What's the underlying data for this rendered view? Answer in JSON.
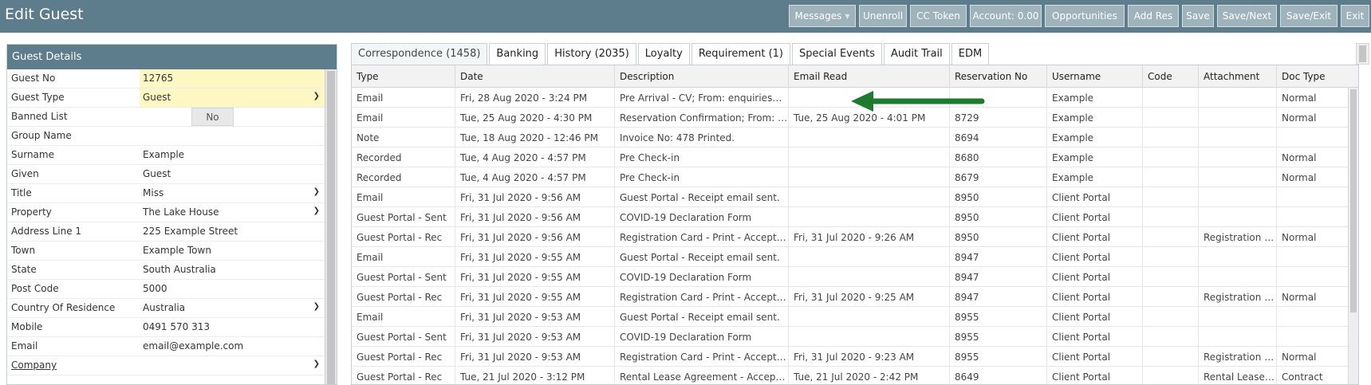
{
  "header": {
    "title": "Edit Guest"
  },
  "toolbar": [
    {
      "label": "Messages",
      "dropdown": true
    },
    {
      "label": "Unenroll"
    },
    {
      "label": "CC Token"
    },
    {
      "label": "Account: 0.00"
    },
    {
      "label": "Opportunities"
    },
    {
      "label": "Add Res"
    },
    {
      "label": "Save"
    },
    {
      "label": "Save/Next"
    },
    {
      "label": "Save/Exit"
    },
    {
      "label": "Exit"
    }
  ],
  "guest_details": {
    "title": "Guest Details",
    "fields": [
      {
        "label": "Guest No",
        "value": "12765"
      },
      {
        "label": "Guest Type",
        "value": "Guest"
      },
      {
        "label": "Banned List",
        "value": "No"
      },
      {
        "label": "Group Name",
        "value": ""
      },
      {
        "label": "Surname",
        "value": "Example"
      },
      {
        "label": "Given",
        "value": "Guest"
      },
      {
        "label": "Title",
        "value": "Miss"
      },
      {
        "label": "Property",
        "value": "The Lake House"
      },
      {
        "label": "Address Line 1",
        "value": "225 Example Street"
      },
      {
        "label": "Town",
        "value": "Example Town"
      },
      {
        "label": "State",
        "value": "South Australia"
      },
      {
        "label": "Post Code",
        "value": "5000"
      },
      {
        "label": "Country Of Residence",
        "value": "Australia"
      },
      {
        "label": "Mobile",
        "value": "0491 570 313"
      },
      {
        "label": "Email",
        "value": "email@example.com"
      },
      {
        "label": "Company",
        "value": ""
      }
    ]
  },
  "tabs": [
    {
      "label": "Correspondence (1458)"
    },
    {
      "label": "Banking"
    },
    {
      "label": "History (2035)"
    },
    {
      "label": "Loyalty"
    },
    {
      "label": "Requirement (1)"
    },
    {
      "label": "Special Events"
    },
    {
      "label": "Audit Trail"
    },
    {
      "label": "EDM"
    }
  ],
  "grid": {
    "columns": [
      "Type",
      "Date",
      "Description",
      "Email Read",
      "Reservation No",
      "Username",
      "Code",
      "Attachment",
      "Doc Type"
    ],
    "rows": [
      [
        "Email",
        "Fri, 28 Aug 2020 - 3:24 PM",
        "Pre Arrival - CV; From: enquiries@yourdomain.com",
        "",
        "",
        "Example",
        "",
        "",
        "Normal"
      ],
      [
        "Email",
        "Tue, 25 Aug 2020 - 4:30 PM",
        "Reservation Confirmation; From: enquiries@yourdomain.com",
        "Tue, 25 Aug 2020 - 4:01 PM",
        "8729",
        "Example",
        "",
        "",
        "Normal"
      ],
      [
        "Note",
        "Tue, 18 Aug 2020 - 12:46 PM",
        "Invoice No: 478 Printed.",
        "",
        "8694",
        "Example",
        "",
        "",
        ""
      ],
      [
        "Recorded",
        "Tue, 4 Aug 2020 - 4:57 PM",
        "Pre Check-in",
        "",
        "8680",
        "Example",
        "",
        "",
        "Normal"
      ],
      [
        "Recorded",
        "Tue, 4 Aug 2020 - 4:57 PM",
        "Pre Check-in",
        "",
        "8679",
        "Example",
        "",
        "",
        "Normal"
      ],
      [
        "Email",
        "Fri, 31 Jul 2020 - 9:56 AM",
        "Guest Portal - Receipt email sent.",
        "",
        "8950",
        "Client Portal",
        "",
        "",
        ""
      ],
      [
        "Guest Portal - Sent",
        "Fri, 31 Jul 2020 - 9:56 AM",
        "COVID-19 Declaration Form",
        "",
        "8950",
        "Client Portal",
        "",
        "",
        ""
      ],
      [
        "Guest Portal - Rec",
        "Fri, 31 Jul 2020 - 9:56 AM",
        "Registration Card - Print - Accepted",
        "Fri, 31 Jul 2020 - 9:26 AM",
        "8950",
        "Client Portal",
        "",
        "Registration Card.pdf",
        "Normal"
      ],
      [
        "Email",
        "Fri, 31 Jul 2020 - 9:55 AM",
        "Guest Portal - Receipt email sent.",
        "",
        "8947",
        "Client Portal",
        "",
        "",
        ""
      ],
      [
        "Guest Portal - Sent",
        "Fri, 31 Jul 2020 - 9:55 AM",
        "COVID-19 Declaration Form",
        "",
        "8947",
        "Client Portal",
        "",
        "",
        ""
      ],
      [
        "Guest Portal - Rec",
        "Fri, 31 Jul 2020 - 9:55 AM",
        "Registration Card - Print - Accepted",
        "Fri, 31 Jul 2020 - 9:25 AM",
        "8947",
        "Client Portal",
        "",
        "Registration Card.pdf",
        "Normal"
      ],
      [
        "Email",
        "Fri, 31 Jul 2020 - 9:53 AM",
        "Guest Portal - Receipt email sent.",
        "",
        "8955",
        "Client Portal",
        "",
        "",
        ""
      ],
      [
        "Guest Portal - Sent",
        "Fri, 31 Jul 2020 - 9:53 AM",
        "COVID-19 Declaration Form",
        "",
        "8955",
        "Client Portal",
        "",
        "",
        ""
      ],
      [
        "Guest Portal - Rec",
        "Fri, 31 Jul 2020 - 9:53 AM",
        "Registration Card - Print - Accepted",
        "Fri, 31 Jul 2020 - 9:23 AM",
        "8955",
        "Client Portal",
        "",
        "Registration Card.pdf",
        "Normal"
      ],
      [
        "Guest Portal - Rec",
        "Tue, 21 Jul 2020 - 3:12 PM",
        "Rental Lease Agreement - Accepted",
        "Tue, 21 Jul 2020 - 2:42 PM",
        "8649",
        "Client Portal",
        "",
        "Rental Lease Agreement.pdf",
        "Contract"
      ]
    ]
  },
  "colors": {
    "header_bg": "#5e7d8c",
    "toolbar_btn": "#9fb3bd",
    "highlight_field": "#fdf7c3",
    "arrow": "#1e7a2e"
  },
  "icons": {
    "dropdown": "chevron-down-icon",
    "annotation": "arrow-left-icon"
  }
}
